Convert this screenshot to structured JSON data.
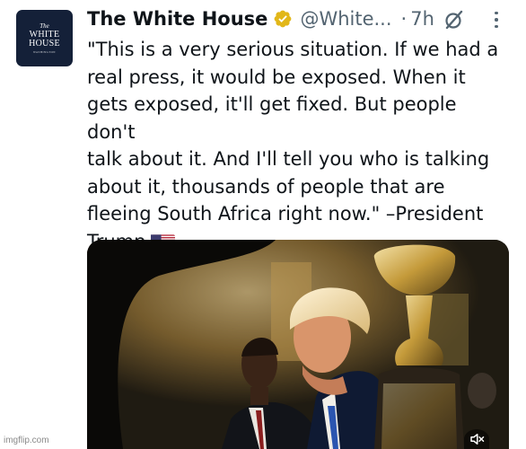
{
  "account": {
    "avatar_logo": {
      "line1": "The",
      "line2": "WHITE",
      "line3": "HOUSE",
      "line4": "WASHINGTON"
    },
    "display_name": "The White House",
    "handle": "@White...",
    "separator": "·",
    "timestamp": "7h",
    "verified_icon": "gold-verified-badge-icon"
  },
  "tweet": {
    "text": "\"This is a very serious situation. If we had a\nreal press, it would be exposed. When it\ngets exposed, it'll get fixed. But people don't\ntalk about it. And I'll tell you who is talking\nabout it, thousands of people that are\nfleeing South Africa right now.\" –President\nTrump",
    "emoji": "us-flag-icon"
  },
  "media": {
    "type": "video",
    "mute_icon": "speaker-muted-icon"
  },
  "watermark": "imgflip.com",
  "colors": {
    "text": "#0f1419",
    "secondary": "#536471",
    "verified": "#e2b719"
  }
}
